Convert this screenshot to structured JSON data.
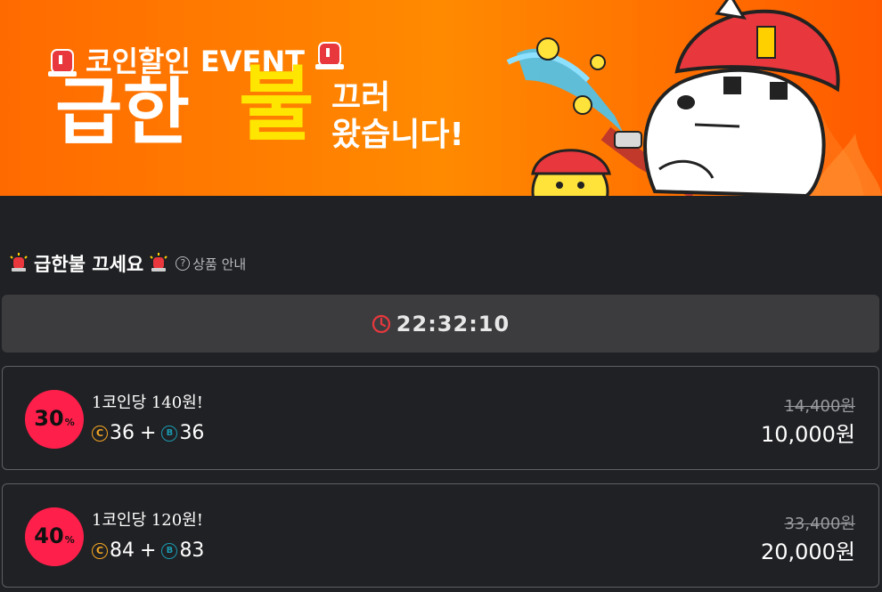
{
  "banner": {
    "event_label": "코인할인 EVENT",
    "headline_main": "급한",
    "headline_highlight": "불",
    "headline_sub_1": "끄러",
    "headline_sub_2": "왔습니다!"
  },
  "section": {
    "title": "급한불 끄세요",
    "info_label": "상품 안내",
    "info_icon": "question-circle-icon"
  },
  "timer": {
    "icon": "clock-icon",
    "value": "22:32:10",
    "icon_color": "#e8383d"
  },
  "products": [
    {
      "discount": "30",
      "discount_unit": "%",
      "unit_price": "1코인당 140원!",
      "coin_amount": "36",
      "bonus_amount": "36",
      "plus": "+",
      "original_price": "14,400원",
      "final_price": "10,000원"
    },
    {
      "discount": "40",
      "discount_unit": "%",
      "unit_price": "1코인당 120원!",
      "coin_amount": "84",
      "bonus_amount": "83",
      "plus": "+",
      "original_price": "33,400원",
      "final_price": "20,000원"
    }
  ],
  "colors": {
    "background": "#202124",
    "banner_orange": "#ff6a00",
    "badge_red": "#ff1f4b",
    "coin_orange": "#f5a623",
    "bonus_teal": "#1a9ab0"
  }
}
